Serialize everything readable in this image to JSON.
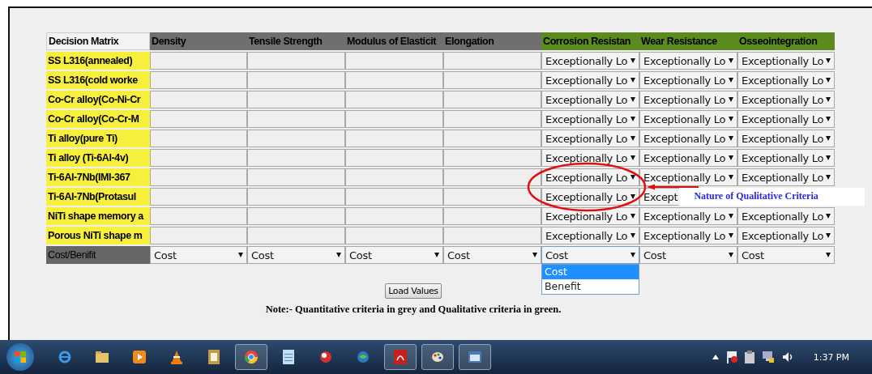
{
  "matrix": {
    "corner": "Decision Matrix",
    "columns": [
      {
        "label": "Density",
        "kind": "quantitative"
      },
      {
        "label": "Tensile Strength",
        "kind": "quantitative"
      },
      {
        "label": "Modulus of Elasticit",
        "kind": "quantitative"
      },
      {
        "label": "Elongation",
        "kind": "quantitative"
      },
      {
        "label": "Corrosion Resistan",
        "kind": "qualitative"
      },
      {
        "label": "Wear Resistance",
        "kind": "qualitative"
      },
      {
        "label": "Osseointegration",
        "kind": "qualitative"
      }
    ],
    "rows": [
      {
        "label": "SS L316(annealed)",
        "grades": [
          "Exceptionally Lo",
          "Exceptionally Lo",
          "Exceptionally Lo"
        ]
      },
      {
        "label": "SS L316(cold worke",
        "grades": [
          "Exceptionally Lo",
          "Exceptionally Lo",
          "Exceptionally Lo"
        ]
      },
      {
        "label": "Co-Cr alloy(Co-Ni-Cr",
        "grades": [
          "Exceptionally Lo",
          "Exceptionally Lo",
          "Exceptionally Lo"
        ]
      },
      {
        "label": "Co-Cr alloy(Co-Cr-M",
        "grades": [
          "Exceptionally Lo",
          "Exceptionally Lo",
          "Exceptionally Lo"
        ]
      },
      {
        "label": "Ti alloy(pure Ti)",
        "grades": [
          "Exceptionally Lo",
          "Exceptionally Lo",
          "Exceptionally Lo"
        ]
      },
      {
        "label": "Ti alloy (Ti-6Al-4v)",
        "grades": [
          "Exceptionally Lo",
          "Exceptionally Lo",
          "Exceptionally Lo"
        ]
      },
      {
        "label": "Ti-6Al-7Nb(IMI-367",
        "grades": [
          "Exceptionally Lo",
          "Exceptionally Lo",
          "Exceptionally Lo"
        ]
      },
      {
        "label": "Ti-6Al-7Nb(Protasul",
        "grades": [
          "Exceptionally Lo",
          "Except"
        ],
        "callout": "Nature of Qualitative Criteria"
      },
      {
        "label": "NiTi shape memory a",
        "grades": [
          "Exceptionally Lo",
          "Exceptionally Lo",
          "Exceptionally Lo"
        ]
      },
      {
        "label": "Porous NiTi shape m",
        "grades": [
          "Exceptionally Lo",
          "Exceptionally Lo",
          "Exceptionally Lo"
        ]
      }
    ],
    "cost_row": {
      "label": "Cost/Benifit",
      "selects": [
        {
          "value": "Cost",
          "open": false
        },
        {
          "value": "Cost",
          "open": false
        },
        {
          "value": "Cost",
          "open": false
        },
        {
          "value": "Cost",
          "open": false
        },
        {
          "value": "Cost",
          "open": true,
          "options": [
            {
              "label": "Cost",
              "selected": true
            },
            {
              "label": "Benefit",
              "selected": false
            }
          ]
        },
        {
          "value": "Cost",
          "open": false
        },
        {
          "value": "Cost",
          "open": false
        }
      ]
    }
  },
  "load_button": "Load Values",
  "note": "Note:- Quantitative criteria in grey and Qualitative criteria in green.",
  "taskbar": {
    "apps": [
      {
        "kind": "ie",
        "running": false
      },
      {
        "kind": "folder",
        "running": false
      },
      {
        "kind": "media",
        "running": false
      },
      {
        "kind": "cone",
        "running": false
      },
      {
        "kind": "word",
        "running": false
      },
      {
        "kind": "chrome",
        "running": true
      },
      {
        "kind": "notepad",
        "running": false
      },
      {
        "kind": "sphere",
        "running": false
      },
      {
        "kind": "globe",
        "running": false
      },
      {
        "kind": "pdf",
        "running": true
      },
      {
        "kind": "paint",
        "running": true
      },
      {
        "kind": "window",
        "running": true
      }
    ],
    "clock": "1:37 PM"
  }
}
